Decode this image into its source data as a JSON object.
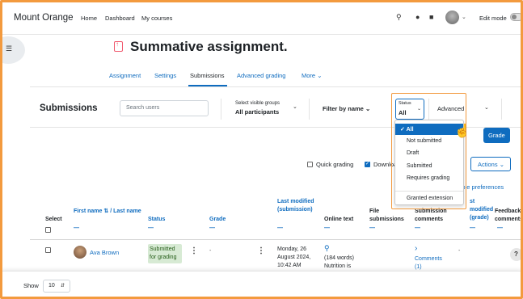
{
  "nav": {
    "brand": "Mount Orange",
    "links": [
      "Home",
      "Dashboard",
      "My courses"
    ],
    "edit_mode": "Edit mode"
  },
  "page": {
    "title": "Summative assignment."
  },
  "tabs": [
    "Assignment",
    "Settings",
    "Submissions",
    "Advanced grading",
    "More"
  ],
  "active_tab": "Submissions",
  "toolbar": {
    "heading": "Submissions",
    "search_placeholder": "Search users",
    "groups_label": "Select visible groups",
    "groups_value": "All participants",
    "filter_by_name": "Filter by name",
    "status_label": "Status",
    "status_value": "All",
    "advanced": "Advanced"
  },
  "status_menu": {
    "items": [
      "All",
      "Not submitted",
      "Draft",
      "Submitted",
      "Requires grading",
      "Granted extension"
    ],
    "selected": "All"
  },
  "buttons": {
    "grade": "Grade",
    "actions": "Actions"
  },
  "options": {
    "quick_grading": "Quick grading",
    "quick_grading_checked": false,
    "download": "Downloa",
    "download_checked": true,
    "visible_prefs": "sible preferences"
  },
  "table": {
    "headers": {
      "select": "Select",
      "first_name": "First name",
      "sort_icon": "⇅",
      "last_name": "/ Last name",
      "status": "Status",
      "grade": "Grade",
      "last_modified_submission": "Last modified (submission)",
      "online_text": "Online text",
      "file_submissions": "File submissions",
      "submission_comments": "Submission comments",
      "last_modified_grade": "st modified (grade)",
      "feedback_comments": "Feedback comments"
    },
    "rows": [
      {
        "name": "Ava Brown",
        "status": "Submitted for grading",
        "grade": "-",
        "last_modified": "Monday, 26 August 2024, 10:42 AM",
        "online_text_words": "(184 words)",
        "online_text_preview": "Nutrition is",
        "comments": "Comments (1)",
        "last_modified_grade": "-"
      }
    ]
  },
  "footer": {
    "show_label": "Show",
    "page_size": "10"
  },
  "colors": {
    "accent": "#0f6cbf",
    "highlight": "#f39a3e",
    "status_badge_bg": "#d7ead4",
    "title_icon": "#f0566b"
  }
}
